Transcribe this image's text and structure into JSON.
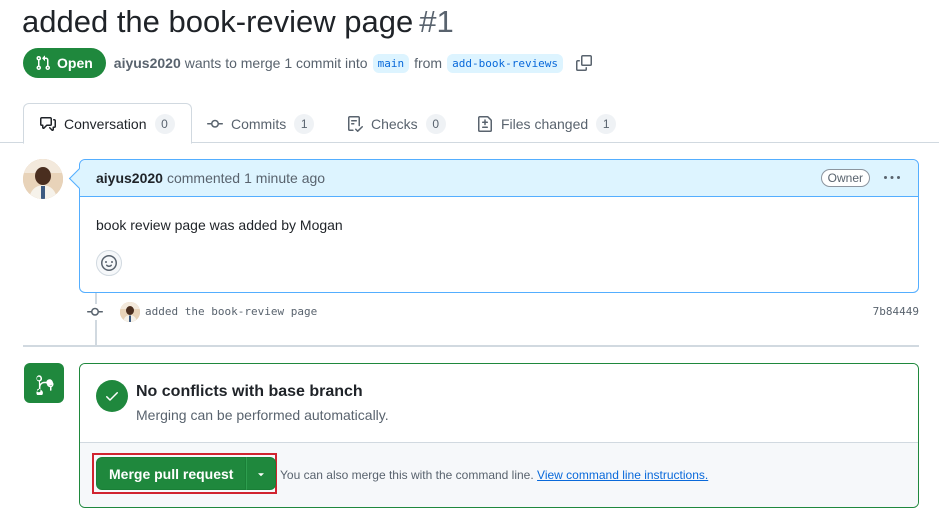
{
  "pr": {
    "title": "added the book-review page",
    "number": "#1",
    "state": "Open",
    "author": "aiyus2020",
    "summary": "wants to merge 1 commit into",
    "base_branch": "main",
    "from_word": "from",
    "head_branch": "add-book-reviews"
  },
  "tabs": [
    {
      "label": "Conversation",
      "count": "0",
      "icon": "comment-discussion-icon",
      "selected": true
    },
    {
      "label": "Commits",
      "count": "1",
      "icon": "git-commit-icon"
    },
    {
      "label": "Checks",
      "count": "0",
      "icon": "checklist-icon"
    },
    {
      "label": "Files changed",
      "count": "1",
      "icon": "file-diff-icon"
    }
  ],
  "comment": {
    "author": "aiyus2020",
    "action": "commented",
    "time": "1 minute ago",
    "role_badge": "Owner",
    "body": "book review page was added by Mogan"
  },
  "commit": {
    "message": "added the book-review page",
    "sha": "7b84449"
  },
  "merge": {
    "status_title": "No conflicts with base branch",
    "status_subtitle": "Merging can be performed automatically.",
    "button_label": "Merge pull request",
    "cli_note": "You can also merge this with the command line.",
    "cli_link": "View command line instructions."
  },
  "colors": {
    "success": "#1f883d",
    "accent": "#0969da",
    "highlight": "#d1242f",
    "comment_header": "#ddf4ff"
  }
}
